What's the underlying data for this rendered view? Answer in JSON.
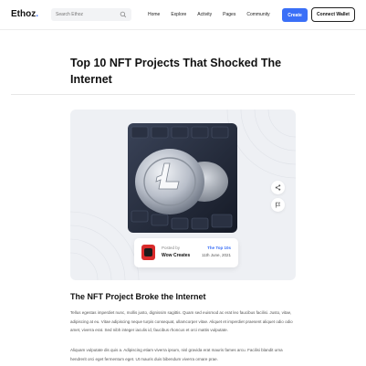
{
  "header": {
    "logo_main": "Ethoz",
    "logo_accent": ".",
    "search_placeholder": "Search Ethoz",
    "nav": [
      "Home",
      "Explore",
      "Activity",
      "Pages",
      "Community"
    ],
    "create_label": "Create",
    "connect_label": "Connect Wallet"
  },
  "article": {
    "title": "Top 10 NFT Projects That Shocked The Internet",
    "card": {
      "posted_label": "Posted by",
      "author": "Wow Creates",
      "tag": "The Top 10s",
      "date": "11th June, 2021"
    },
    "section_title": "The NFT Project Broke the Internet",
    "paragraph1": "Tellus egestas imperdiet nunc, mollis justo, dignissim sagittis. Quam sed euismod ac erat leo faucibus facilisi. Justo, vitae, adipiscing at eu. Vitae adipiscing neque turpis consequat, ullamcorper vitae. Aliquet et imperdiet praesent aliquet odio odio amet, viverra erat. Sed nibh integer iaculis id, faucibus rhoncus et orci mattis vulputate.",
    "paragraph2": "Aliquam vulputate dis quis a. Adipiscing etiam viverra ipsum, nisl gravida erat mauris fames arcu. Facilisi blandit urna hendrerit orci eget fermentum eget. Ut mauris duis bibendum viverra ornare prae."
  },
  "colors": {
    "accent": "#3a6ff7",
    "thumb": "#d92b2b"
  }
}
